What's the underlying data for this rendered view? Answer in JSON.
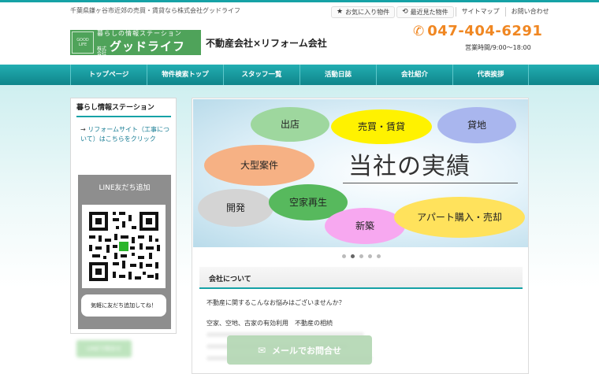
{
  "header": {
    "tagline": "千葉県鎌ヶ谷市近郊の売買・賃貸なら株式会社グッドライフ",
    "favorites_label": "お気に入り物件",
    "recent_label": "最近見た物件",
    "sitemap_label": "サイトマップ",
    "contact_label": "お問い合わせ",
    "logo": {
      "line1": "暮らしの情報ステーション",
      "kabushiki": "株式会社",
      "name": "グッドライフ"
    },
    "company_type": "不動産会社×リフォーム会社",
    "phone": "047-404-6291",
    "hours": "営業時間/9:00～18:00"
  },
  "nav": {
    "items": [
      "トップページ",
      "物件検索トップ",
      "スタッフ一覧",
      "活動日誌",
      "会社紹介",
      "代表挨拶"
    ]
  },
  "sidebar": {
    "title": "暮らし情報ステーション",
    "link_arrow": "→",
    "link_text": "リフォームサイト（工事について）はこちらをクリック",
    "line_title": "LINE友だち追加",
    "line_bubble": "気軽に友だち追加してね！"
  },
  "slider": {
    "labels": {
      "shutten": "出店",
      "baibai": "売買・賃貸",
      "kashiten": "貸地",
      "oogata": "大型案件",
      "kaihatsu": "開発",
      "akiya": "空家再生",
      "shinchiku": "新築",
      "apart": "アパート購入・売却"
    },
    "headline": "当社の実績",
    "active_index": 1,
    "count": 5,
    "colors": {
      "green": "#9ed79e",
      "yellow": "#fff200",
      "blue": "#a9b6ee",
      "orange": "#f6b184",
      "gray": "#d4d4d4",
      "darkgreen": "#57b95d",
      "pink": "#f7a8f0",
      "lightyellow": "#ffe25c"
    }
  },
  "about": {
    "title": "会社について",
    "line1": "不動産に関するこんなお悩みはございませんか？",
    "line2": "空家、空地、古家の有効利用　不動産の相続"
  },
  "footer_buttons": {
    "mail_label": "メールでお問合せ",
    "left_label": "LINEで問合せ"
  },
  "theme": {
    "accent": "#16a2a6",
    "phone_orange": "#f08722",
    "logo_green": "#4fa35a"
  }
}
